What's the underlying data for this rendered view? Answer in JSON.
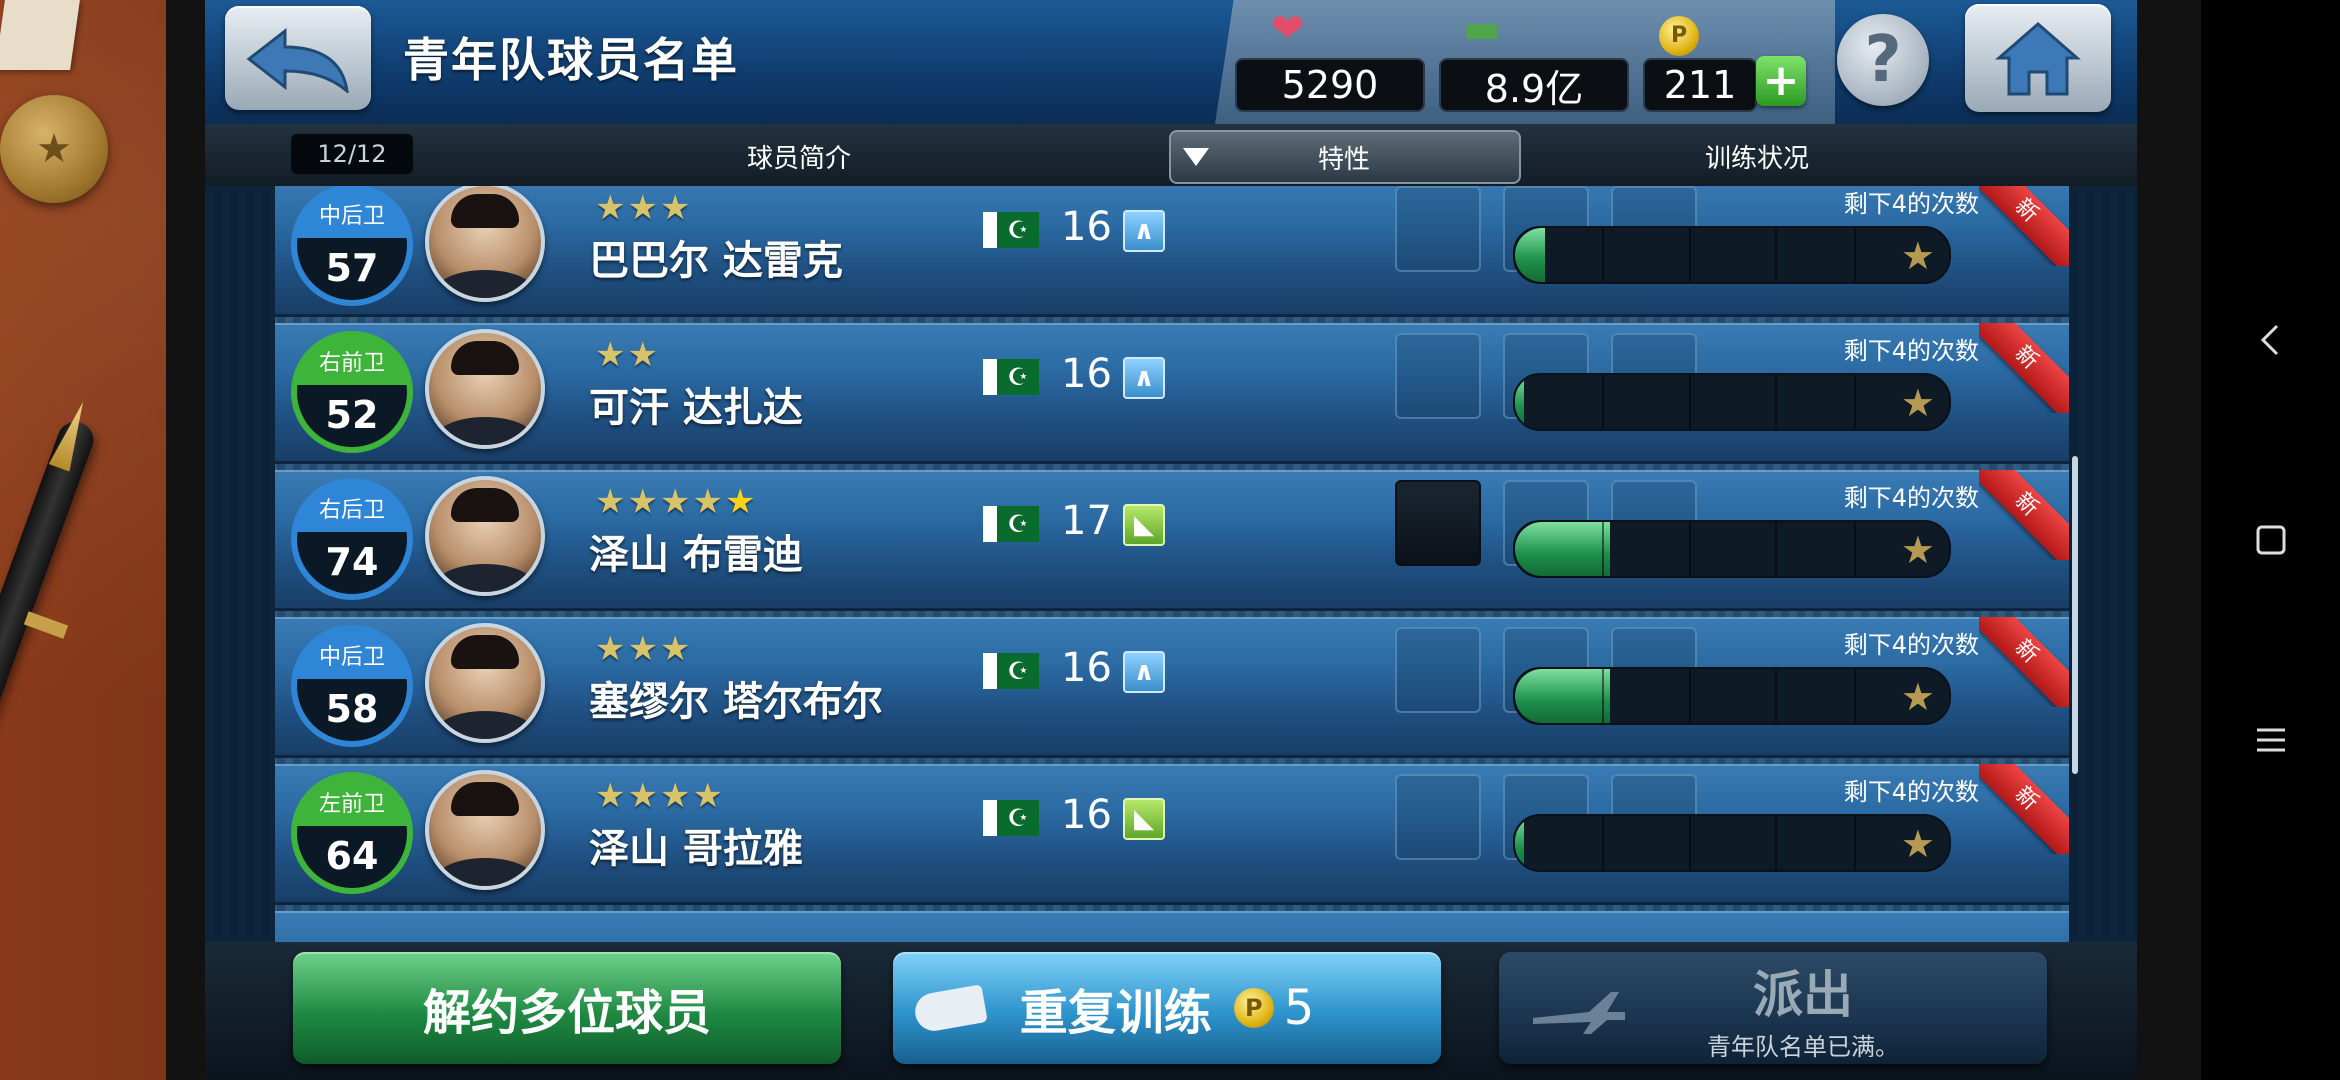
{
  "header": {
    "title": "青年队球员名单",
    "resources": [
      {
        "icon": "handshake-icon",
        "value": "5290"
      },
      {
        "icon": "money-icon",
        "value": "8.9亿"
      },
      {
        "icon": "coin-icon",
        "value": "211"
      }
    ],
    "coin_symbol": "P",
    "help_label": "?"
  },
  "subheader": {
    "count": "12/12",
    "col_profile": "球员简介",
    "col_traits": "特性",
    "col_training": "训练状况"
  },
  "players": [
    {
      "position": "中后卫",
      "position_group": "defender",
      "rating": "57",
      "stars": 3,
      "gold_stars": 0,
      "name": "巴巴尔 达雷克",
      "flag": "☪",
      "age": "16",
      "growth": "early",
      "trait_slots": [
        false,
        false,
        false
      ],
      "remaining": "剩下4的次数",
      "training_progress": 0.07,
      "new_label": "新"
    },
    {
      "position": "右前卫",
      "position_group": "midfielder",
      "rating": "52",
      "stars": 2,
      "gold_stars": 0,
      "name": "可汗 达扎达",
      "flag": "☪",
      "age": "16",
      "growth": "early",
      "trait_slots": [
        false,
        false,
        false
      ],
      "remaining": "剩下4的次数",
      "training_progress": 0.02,
      "new_label": "新"
    },
    {
      "position": "右后卫",
      "position_group": "defender",
      "rating": "74",
      "stars": 5,
      "gold_stars": 1,
      "name": "泽山 布雷迪",
      "flag": "☪",
      "age": "17",
      "growth": "late",
      "trait_slots": [
        true,
        false,
        false
      ],
      "remaining": "剩下4的次数",
      "training_progress": 0.22,
      "new_label": "新"
    },
    {
      "position": "中后卫",
      "position_group": "defender",
      "rating": "58",
      "stars": 3,
      "gold_stars": 0,
      "name": "塞缪尔 塔尔布尔",
      "flag": "☪",
      "age": "16",
      "growth": "early",
      "trait_slots": [
        false,
        false,
        false
      ],
      "remaining": "剩下4的次数",
      "training_progress": 0.22,
      "new_label": "新"
    },
    {
      "position": "左前卫",
      "position_group": "midfielder",
      "rating": "64",
      "stars": 4,
      "gold_stars": 0,
      "name": "泽山 哥拉雅",
      "flag": "☪",
      "age": "16",
      "growth": "late",
      "trait_slots": [
        false,
        false,
        false
      ],
      "remaining": "剩下4的次数",
      "training_progress": 0.02,
      "new_label": "新"
    }
  ],
  "footer": {
    "release_label": "解约多位球员",
    "train_label": "重复训练",
    "train_cost": "5",
    "dispatch_label": "派出",
    "dispatch_sub": "青年队名单已满。"
  },
  "colors": {
    "defender": "#2f86d6",
    "midfielder": "#3fb43a",
    "accent_green": "#1f8a43",
    "accent_blue": "#2e93cc"
  }
}
